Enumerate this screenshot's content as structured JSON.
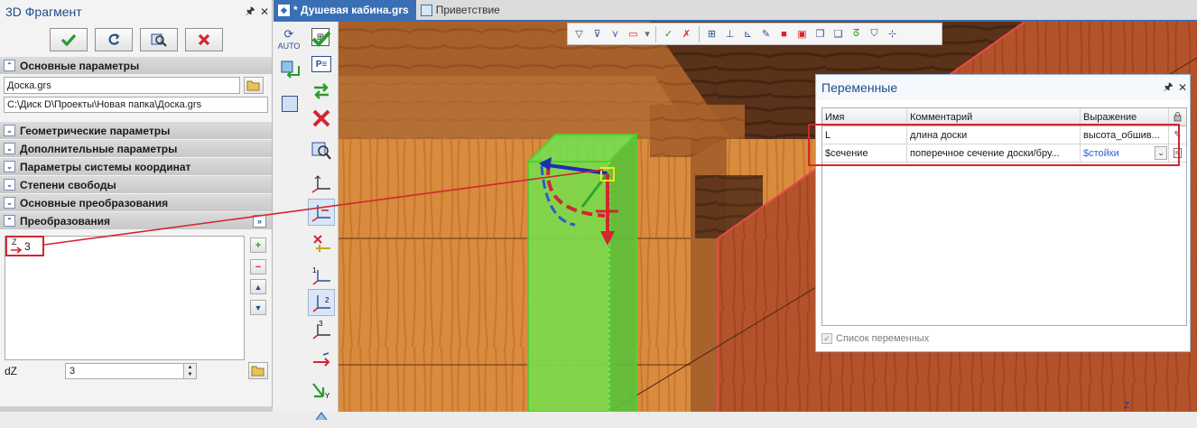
{
  "fragment_panel": {
    "title": "3D Фрагмент",
    "sections": {
      "main_params": "Основные параметры",
      "geometric": "Геометрические параметры",
      "additional": "Дополнительные параметры",
      "coord_system": "Параметры системы координат",
      "dof": "Степени свободы",
      "main_transforms": "Основные преобразования",
      "transforms": "Преобразования"
    },
    "file_name": "Доска.grs",
    "file_path": "C:\\Диск D\\Проекты\\Новая папка\\Доска.grs",
    "transform_item": "3",
    "transform_icon_letter": "Z",
    "dz_label": "dZ",
    "dz_value": "3"
  },
  "tabs": [
    {
      "label": "* Душевая кабина.grs",
      "active": true
    },
    {
      "label": "Приветствие",
      "active": false
    }
  ],
  "vertical_toolbar": {
    "auto_label": "AUTO"
  },
  "variables_panel": {
    "title": "Переменные",
    "columns": [
      "Имя",
      "Комментарий",
      "Выражение"
    ],
    "rows": [
      {
        "name": "L",
        "comment": "длина доски",
        "expression": "высота_обшив..."
      },
      {
        "name": "$сечение",
        "comment": "поперечное сечение доски/бру...",
        "expression": "$стойки"
      }
    ],
    "checkbox_label": "Список переменных"
  },
  "colors": {
    "accent": "#3a6fb5",
    "highlight_red": "#d32630",
    "selection_green": "#59d63c",
    "title_blue": "#1e4e89"
  },
  "axis_label": "Z"
}
